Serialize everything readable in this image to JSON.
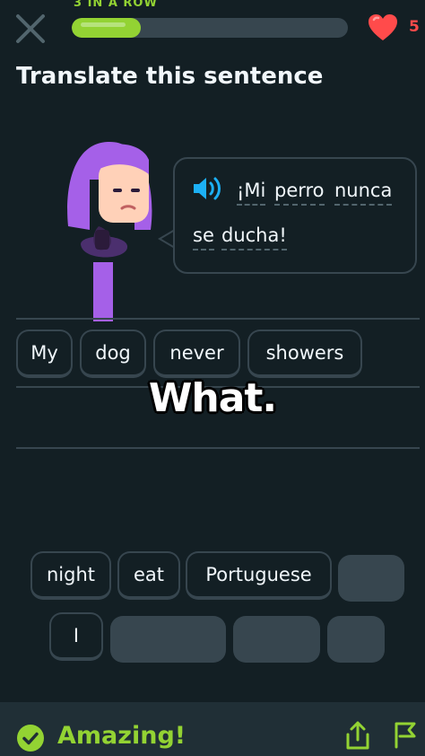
{
  "header": {
    "streak_label": "3 IN A ROW",
    "progress": 0.25,
    "hearts": "5"
  },
  "exercise": {
    "title": "Translate this sentence",
    "sentence_words": [
      "¡Mi",
      "perro",
      "nunca",
      "se",
      "ducha!"
    ]
  },
  "answer": {
    "chips": [
      "My",
      "dog",
      "never",
      "showers"
    ]
  },
  "overlay_caption": "What.",
  "word_bank": {
    "chips": [
      "night",
      "eat",
      "Portuguese",
      "I"
    ]
  },
  "footer": {
    "feedback": "Amazing!"
  },
  "colors": {
    "background": "#131f24",
    "accent_green": "#93d333",
    "heart_red": "#ff4b4b",
    "border": "#37464f",
    "character_purple": "#a560e8"
  }
}
